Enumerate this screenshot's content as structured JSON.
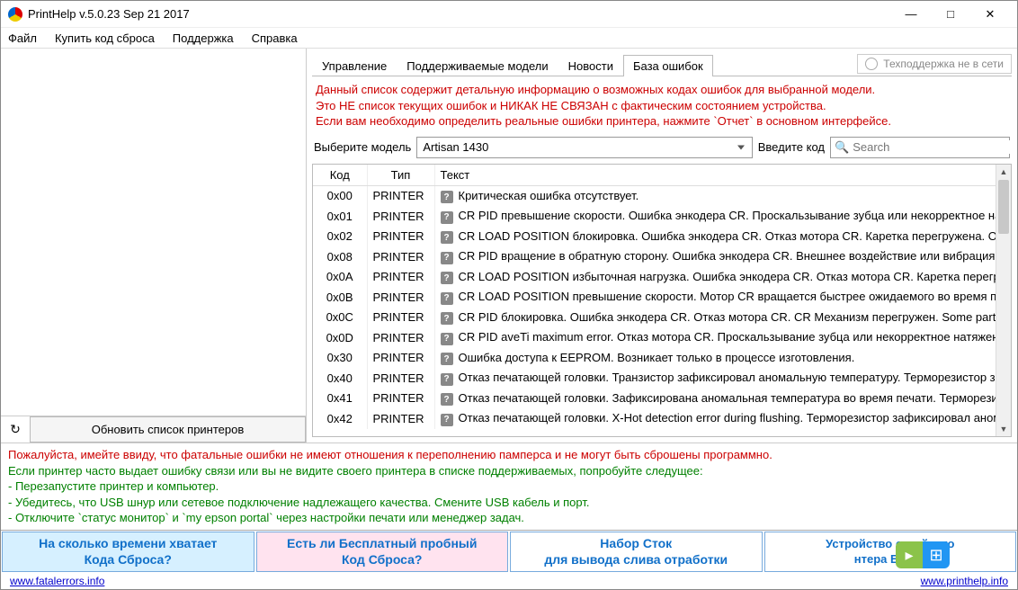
{
  "window": {
    "title": "PrintHelp v.5.0.23 Sep 21 2017"
  },
  "menu": {
    "file": "Файл",
    "buy": "Купить код сброса",
    "support": "Поддержка",
    "help": "Справка"
  },
  "leftpanel": {
    "refresh_label": "Обновить список принтеров"
  },
  "tabs": {
    "control": "Управление",
    "supported": "Поддерживаемые модели",
    "news": "Новости",
    "errors": "База ошибок"
  },
  "support_status": "Техподдержка не в сети",
  "warn_lines": [
    "Данный список содержит детальную информацию о возможных кодах ошибок для выбранной модели.",
    "Это НЕ список текущих ошибок и НИКАК НЕ СВЯЗАН с фактическим состоянием устройства.",
    "Если вам необходимо определить реальные ошибки принтера, нажмите `Отчет` в основном интерфейсе."
  ],
  "filter": {
    "model_label": "Выберите модель",
    "model_value": "Artisan 1430",
    "code_label": "Введите код",
    "search_placeholder": "Search"
  },
  "grid": {
    "headers": {
      "code": "Код",
      "type": "Тип",
      "text": "Текст"
    },
    "rows": [
      {
        "code": "0x00",
        "type": "PRINTER",
        "text": "Критическая ошибка отсутствует."
      },
      {
        "code": "0x01",
        "type": "PRINTER",
        "text": "CR PID превышение скорости. Ошибка энкодера CR. Проскальзывание зубца или некорректное натяжение зубча"
      },
      {
        "code": "0x02",
        "type": "PRINTER",
        "text": "CR LOAD POSITION блокировка. Ошибка энкодера CR. Отказ мотора CR. Каретка перегружена. Отсоединение каб"
      },
      {
        "code": "0x08",
        "type": "PRINTER",
        "text": "CR PID вращение в обратную сторону. Ошибка энкодера CR. Внешнее воздействие или вибрация. Проскальзыван"
      },
      {
        "code": "0x0A",
        "type": "PRINTER",
        "text": "CR LOAD POSITION избыточная нагрузка. Ошибка энкодера CR. Отказ мотора CR. Каретка перегружена. Проскалы"
      },
      {
        "code": "0x0B",
        "type": "PRINTER",
        "text": "CR LOAD POSITION превышение скорости. Мотор CR вращается быстрее ожидаемого во время печати. Ошибка "
      },
      {
        "code": "0x0C",
        "type": "PRINTER",
        "text": "CR PID блокировка. Ошибка энкодера CR. Отказ мотора CR. CR Механизм перегружен. Some part may be detachec"
      },
      {
        "code": "0x0D",
        "type": "PRINTER",
        "text": "CR PID aveTi maximum error. Отказ мотора CR. Проскальзывание зубца или некорректное натяжение зубчатого ре"
      },
      {
        "code": "0x30",
        "type": "PRINTER",
        "text": "Ошибка доступа к EEPROM. Возникает только в процессе изготовления."
      },
      {
        "code": "0x40",
        "type": "PRINTER",
        "text": "Отказ печатающей головки. Транзистор зафиксировал аномальную температуру. Терморезистор зафиксировал "
      },
      {
        "code": "0x41",
        "type": "PRINTER",
        "text": "Отказ печатающей головки. Зафиксирована аномальная температура во время печати. Терморезистор зафиксир"
      },
      {
        "code": "0x42",
        "type": "PRINTER",
        "text": "Отказ печатающей головки. X-Hot detection error during flushing. Терморезистор зафиксировал аномальную тем"
      }
    ]
  },
  "bottom": {
    "fatal": "Пожалуйста, имейте ввиду, что фатальные ошибки не имеют отношения к переполнению памперса и не могут быть сброшены программно.",
    "intro": "Если принтер часто выдает ошибку связи или вы не видите своего принтера в списке поддерживаемых, попробуйте следущее:",
    "l1": "- Перезапустите принтер и компьютер.",
    "l2": "- Убедитесь, что USB шнур или сетевое подключение надлежащего качества. Смените USB кабель и порт.",
    "l3": "- Отключите `статус монитор` и `my epson portal` через настройки печати или менеджер задач."
  },
  "ads": {
    "a1_l1": "На сколько времени хватает",
    "a1_l2": "Кода Сброса?",
    "a2_l1": "Есть ли Бесплатный пробный",
    "a2_l2": "Код Сброса?",
    "a3_l1": "Набор Сток",
    "a3_l2": "для вывода слива отработки",
    "a4_l1": "Устройство струйного",
    "a4_l2": "нтера Epson"
  },
  "footer": {
    "left": "www.fatalerrors.info",
    "right": "www.printhelp.info"
  }
}
